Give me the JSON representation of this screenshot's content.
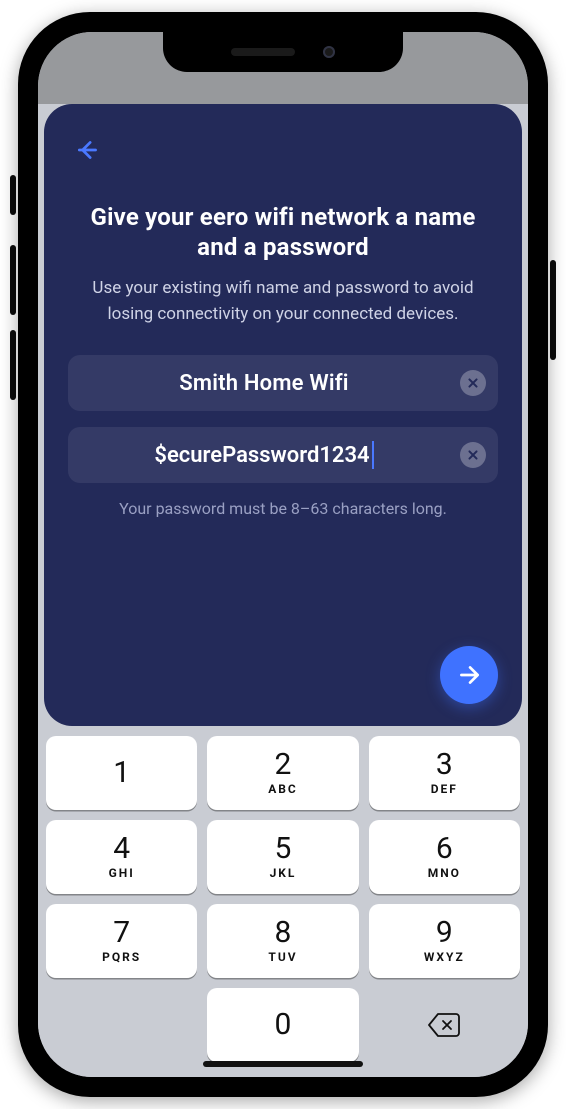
{
  "title": "Give your eero wifi network a name and a password",
  "subtitle": "Use your existing wifi name and password to avoid losing connectivity on your connected devices.",
  "fields": {
    "network_name": {
      "value": "Smith Home Wifi"
    },
    "password": {
      "value": "$ecurePassword1234"
    }
  },
  "hint": "Your password must be 8–63 characters long.",
  "keypad": {
    "keys": [
      {
        "digit": "1",
        "letters": ""
      },
      {
        "digit": "2",
        "letters": "ABC"
      },
      {
        "digit": "3",
        "letters": "DEF"
      },
      {
        "digit": "4",
        "letters": "GHI"
      },
      {
        "digit": "5",
        "letters": "JKL"
      },
      {
        "digit": "6",
        "letters": "MNO"
      },
      {
        "digit": "7",
        "letters": "PQRS"
      },
      {
        "digit": "8",
        "letters": "TUV"
      },
      {
        "digit": "9",
        "letters": "WXYZ"
      }
    ],
    "zero": {
      "digit": "0",
      "letters": ""
    }
  }
}
